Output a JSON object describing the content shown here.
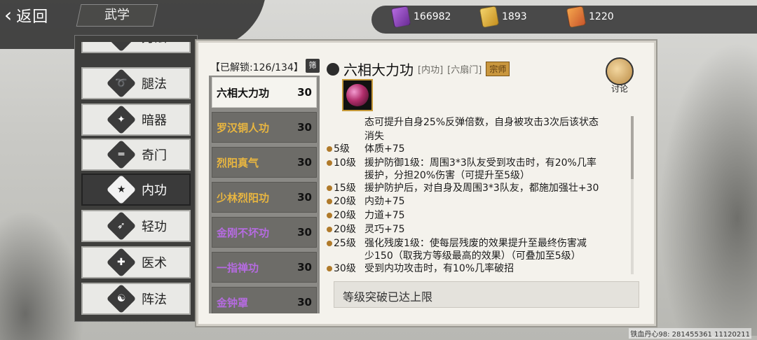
{
  "top": {
    "back_label": "返回",
    "title": "武学",
    "resources": [
      {
        "icon": "purple-scroll-icon",
        "value": "166982",
        "color": "#8c3cc0"
      },
      {
        "icon": "gold-scroll-icon",
        "value": "1893",
        "color": "#e0b040"
      },
      {
        "icon": "orange-scroll-icon",
        "value": "1220",
        "color": "#e0782f"
      }
    ]
  },
  "categories": [
    {
      "label": "刀法",
      "icon": "blade-icon"
    },
    {
      "label": "腿法",
      "icon": "kick-icon"
    },
    {
      "label": "暗器",
      "icon": "shuriken-icon"
    },
    {
      "label": "奇门",
      "icon": "scroll-weapon-icon"
    },
    {
      "label": "内功",
      "icon": "martial-pose-icon",
      "active": true
    },
    {
      "label": "轻功",
      "icon": "lightness-icon"
    },
    {
      "label": "医术",
      "icon": "medicine-icon"
    },
    {
      "label": "阵法",
      "icon": "yinyang-icon"
    }
  ],
  "unlock_text": "【已解锁:126/134】",
  "filter_label": "筛",
  "skills": [
    {
      "name": "六相大力功",
      "level": "30",
      "color": "#111111",
      "active": true
    },
    {
      "name": "罗汉铜人功",
      "level": "30",
      "color": "#e9b640"
    },
    {
      "name": "烈阳真气",
      "level": "30",
      "color": "#e9b640"
    },
    {
      "name": "少林烈阳功",
      "level": "30",
      "color": "#e9b640"
    },
    {
      "name": "金刚不坏功",
      "level": "30",
      "color": "#b56be0"
    },
    {
      "name": "一指禅功",
      "level": "30",
      "color": "#b56be0"
    },
    {
      "name": "金钟罩",
      "level": "30",
      "color": "#b56be0"
    }
  ],
  "detail": {
    "name": "六相大力功",
    "tag_type": "[内功]",
    "tag_sect": "[六扇门]",
    "rank": "宗师",
    "discuss_label": "讨论",
    "lines": [
      {
        "level": "",
        "text": "态可提升自身25%反弹倍数，自身被攻击3次后该状态",
        "dot": false
      },
      {
        "level": "",
        "text": "消失",
        "dot": false
      },
      {
        "level": "5级",
        "text": "体质+75",
        "dot": true
      },
      {
        "level": "10级",
        "text": "援护防御1级：周围3*3队友受到攻击时，有20%几率",
        "dot": true
      },
      {
        "level": "",
        "text": "援护，分担20%伤害（可提升至5级）",
        "dot": false
      },
      {
        "level": "15级",
        "text": "援护防护后，对自身及周围3*3队友，都施加强壮+30",
        "dot": true
      },
      {
        "level": "20级",
        "text": "内劲+75",
        "dot": true
      },
      {
        "level": "20级",
        "text": "力道+75",
        "dot": true
      },
      {
        "level": "20级",
        "text": "灵巧+75",
        "dot": true
      },
      {
        "level": "25级",
        "text": "强化残废1级：使每层残废的效果提升至最终伤害减",
        "dot": true
      },
      {
        "level": "",
        "text": "少150（取我方等级最高的效果）（可叠加至5级）",
        "dot": false
      },
      {
        "level": "30级",
        "text": "受到内功攻击时，有10%几率破招",
        "dot": true
      }
    ],
    "max_text": "等级突破已达上限"
  },
  "watermark": "铁血丹心98: 281455361 11120211"
}
